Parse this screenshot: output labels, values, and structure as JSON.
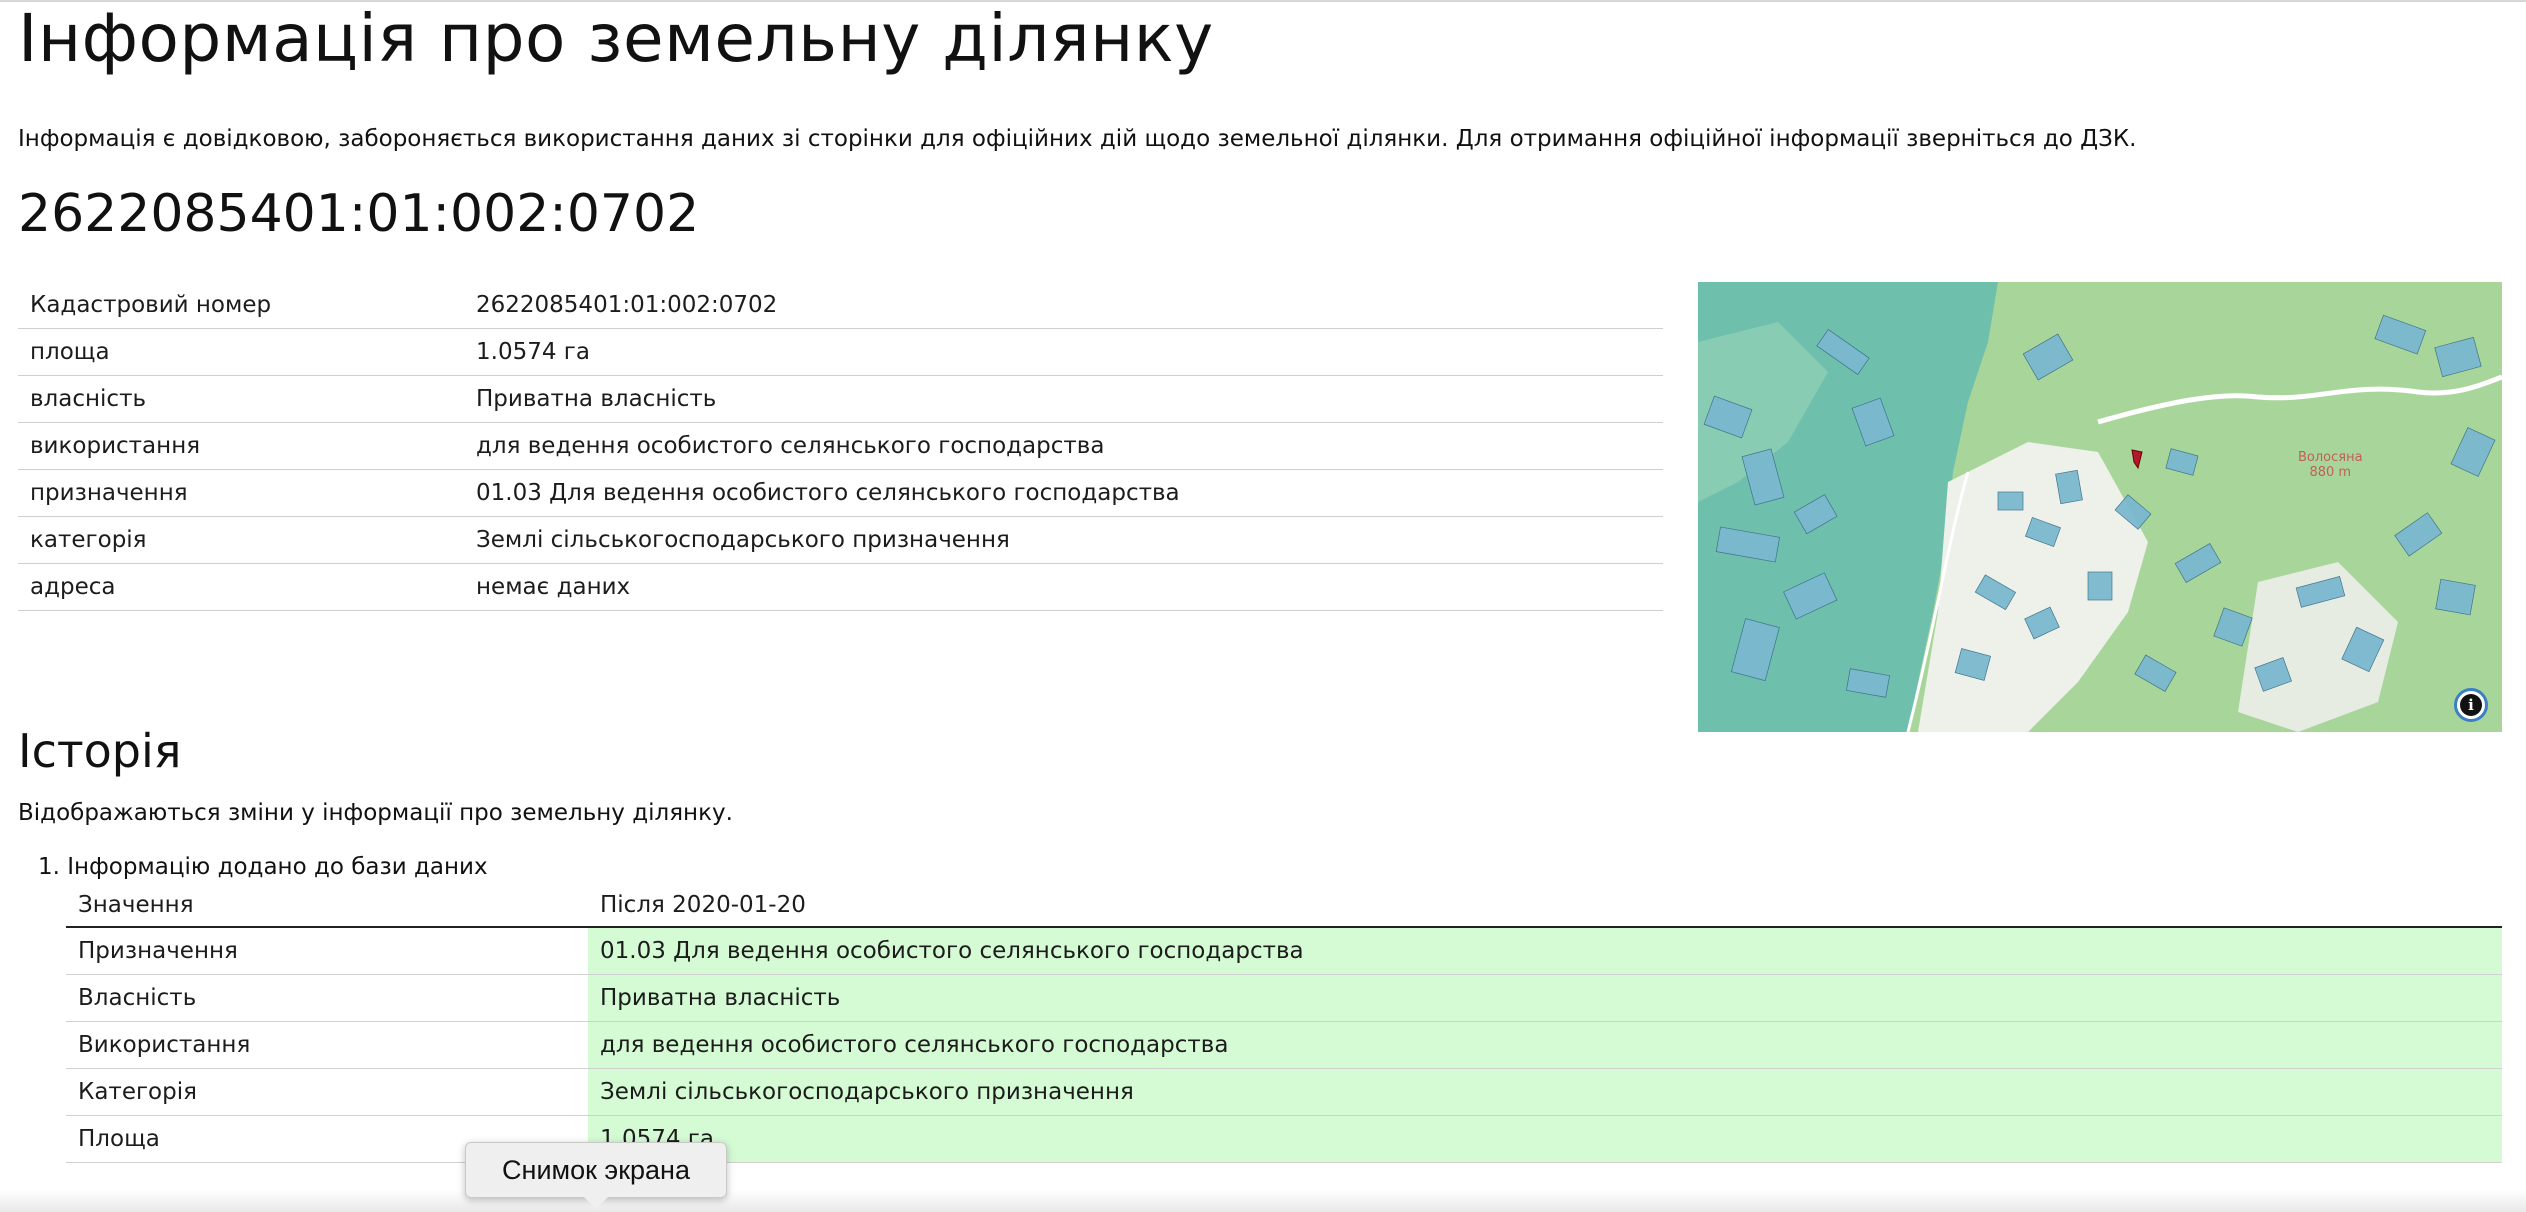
{
  "page_title": "Інформація про земельну ділянку",
  "notice": "Інформація є довідковою, забороняється використання даних зі сторінки для офіційних дій щодо земельної ділянки. Для отримання офіційної інформації зверніться до ДЗК.",
  "cadastral_heading": "2622085401:01:002:0702",
  "info_rows": [
    {
      "label": "Кадастровий номер",
      "value": "2622085401:01:002:0702"
    },
    {
      "label": "площа",
      "value": "1.0574 га"
    },
    {
      "label": "власність",
      "value": "Приватна власність"
    },
    {
      "label": "використання",
      "value": "для ведення особистого селянського господарства"
    },
    {
      "label": "призначення",
      "value": "01.03 Для ведення особистого селянського господарства"
    },
    {
      "label": "категорія",
      "value": "Землі сільськогосподарського призначення"
    },
    {
      "label": "адреса",
      "value": "немає даних"
    }
  ],
  "map": {
    "place_name": "Волосяна",
    "place_elevation": "880 m",
    "info_icon": "info-icon",
    "colors": {
      "forest": "#a8d69a",
      "water": "#7fc3a9",
      "parcel": "#7ab8cf",
      "marker": "#b3172c"
    }
  },
  "history": {
    "heading": "Історія",
    "description": "Відображаються зміни у інформації про земельну ділянку.",
    "item_title": "1. Інформацію додано до бази даних",
    "col_key": "Значення",
    "col_value": "Після 2020-01-20",
    "rows": [
      {
        "label": "Призначення",
        "value": "01.03 Для ведення особистого селянського господарства"
      },
      {
        "label": "Власність",
        "value": "Приватна власність"
      },
      {
        "label": "Використання",
        "value": "для ведення особистого селянського господарства"
      },
      {
        "label": "Категорія",
        "value": "Землі сільськогосподарського призначення"
      },
      {
        "label": "Площа",
        "value": "1.0574 га"
      }
    ]
  },
  "tooltip": "Снимок экрана"
}
